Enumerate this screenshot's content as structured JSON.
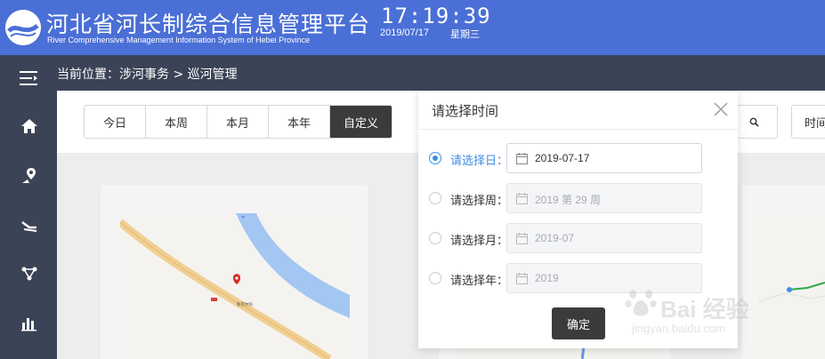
{
  "header": {
    "title": "河北省河长制综合信息管理平台",
    "subtitle": "River Comprehensive Management Information  System of Hebei Province",
    "time": "17:19:39",
    "date": "2019/07/17",
    "weekday": "星期三"
  },
  "breadcrumb": {
    "text": "当前位置：涉河事务 > 巡河管理"
  },
  "sidebar": {
    "items": [
      "menu-toggle-icon",
      "home-icon",
      "location-pin-icon",
      "river-icon",
      "network-icon",
      "bar-chart-icon"
    ]
  },
  "toolbar": {
    "tabs": [
      {
        "label": "今日",
        "active": false
      },
      {
        "label": "本周",
        "active": false
      },
      {
        "label": "本月",
        "active": false
      },
      {
        "label": "本年",
        "active": false
      },
      {
        "label": "自定义",
        "active": true
      }
    ],
    "time_label": "时间"
  },
  "modal": {
    "title": "请选择时间",
    "options": [
      {
        "label": "请选择日：",
        "value": "2019-07-17",
        "checked": true,
        "disabled": false
      },
      {
        "label": "请选择周：",
        "value": "2019 第 29 周",
        "checked": false,
        "disabled": true
      },
      {
        "label": "请选择月：",
        "value": "2019-07",
        "checked": false,
        "disabled": true
      },
      {
        "label": "请选择年：",
        "value": "2019",
        "checked": false,
        "disabled": true
      }
    ],
    "confirm_label": "确定"
  },
  "map": {
    "marker_label": "新巴尔科"
  },
  "watermark": {
    "brand": "Bai 经验",
    "url": "jingyan.baidu.com"
  },
  "colors": {
    "header_bg": "#4a6fd6",
    "sidebar_bg": "#3b4356",
    "accent": "#3a8ee6",
    "active_tab": "#3b3b3b"
  }
}
